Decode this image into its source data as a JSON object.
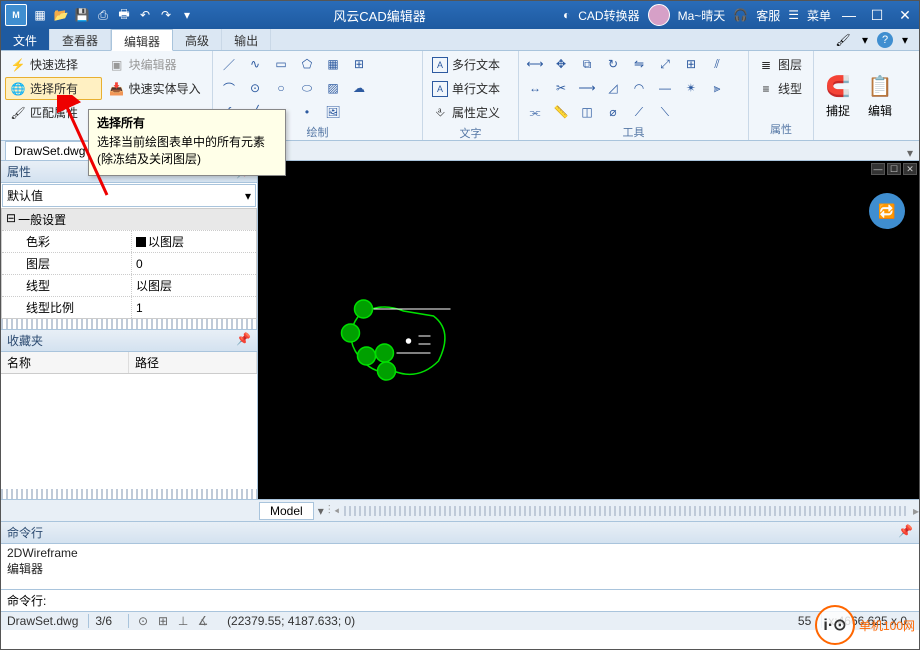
{
  "titlebar": {
    "app_icon_text": "M",
    "title": "风云CAD编辑器",
    "cad_converter": "CAD转换器",
    "username": "Ma~晴天",
    "kefu": "客服",
    "menu": "菜单"
  },
  "maintabs": {
    "file": "文件",
    "viewer": "查看器",
    "editor": "编辑器",
    "advanced": "高级",
    "output": "输出"
  },
  "ribbon": {
    "quick_select": "快速选择",
    "block_editor": "块编辑器",
    "select_all": "选择所有",
    "quick_entity_import": "快速实体导入",
    "match_props": "匹配属性",
    "group_draw": "绘制",
    "multi_text": "多行文本",
    "single_text": "单行文本",
    "attr_def": "属性定义",
    "group_text": "文字",
    "group_tools": "工具",
    "layers": "图层",
    "linetype": "线型",
    "group_props": "属性",
    "snap": "捕捉",
    "edit": "编辑"
  },
  "doc": {
    "tab": "DrawSet.dwg",
    "close": "×"
  },
  "panel": {
    "props_title": "属性",
    "default": "默认值",
    "section_general": "一般设置",
    "color": "色彩",
    "color_val": "以图层",
    "layer": "图层",
    "layer_val": "0",
    "linetype": "线型",
    "linetype_val": "以图层",
    "ltscale": "线型比例",
    "ltscale_val": "1",
    "fav_title": "收藏夹",
    "col_name": "名称",
    "col_path": "路径"
  },
  "canvas": {
    "model_tab": "Model"
  },
  "cmd": {
    "header": "命令行",
    "line1": "2DWireframe",
    "line2": "编辑器",
    "prompt": "命令行:"
  },
  "status": {
    "file": "DrawSet.dwg",
    "ratio": "3/6",
    "coords": "(22379.55; 4187.633; 0)",
    "coords2": "x:4666.625 x 0",
    "right_num": "55"
  },
  "tooltip": {
    "title": "选择所有",
    "body1": "选择当前绘图表单中的所有元素",
    "body2": "(除冻结及关闭图层)"
  },
  "watermark": {
    "logo_text": "i·⊙",
    "label": "单机100网"
  }
}
